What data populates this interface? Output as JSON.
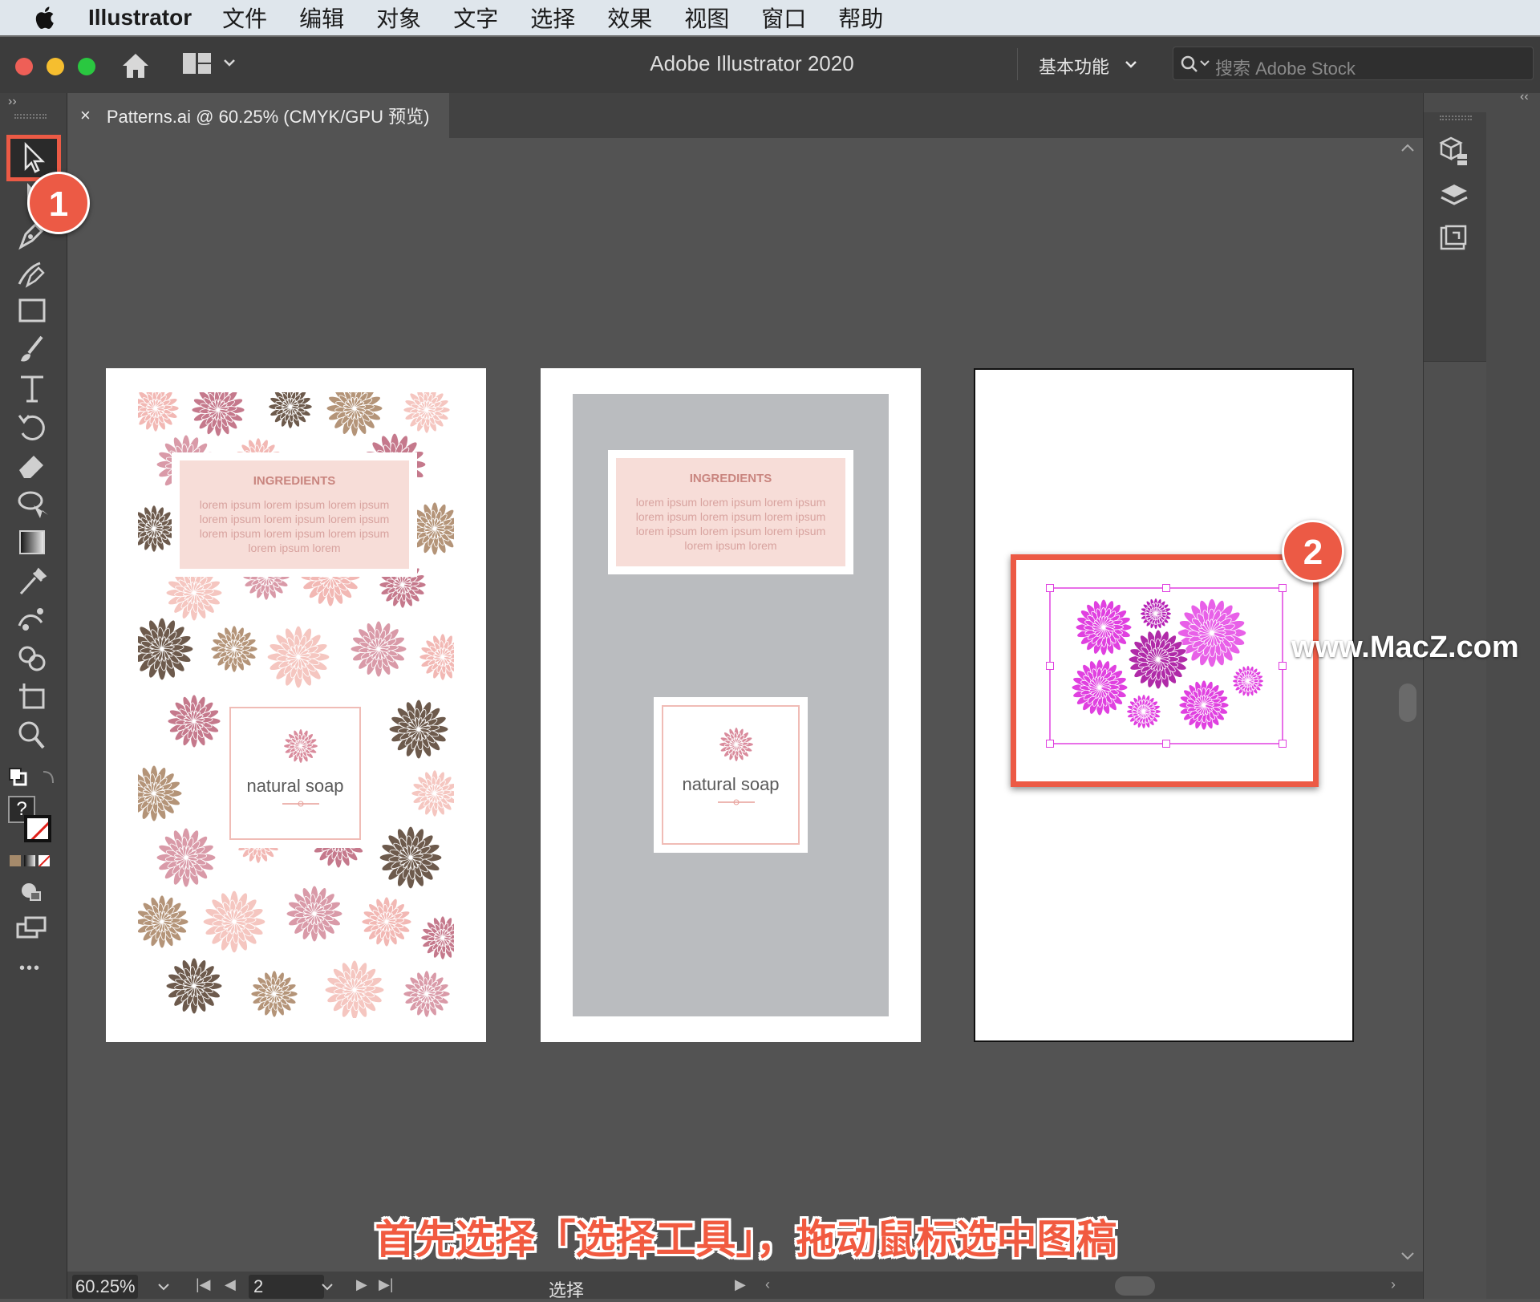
{
  "menubar": {
    "app_name": "Illustrator",
    "items": [
      "文件",
      "编辑",
      "对象",
      "文字",
      "选择",
      "效果",
      "视图",
      "窗口",
      "帮助"
    ]
  },
  "titlebar": {
    "title": "Adobe Illustrator 2020",
    "workspace": "基本功能",
    "search_placeholder": "搜索 Adobe Stock"
  },
  "document_tab": {
    "close": "×",
    "label": "Patterns.ai @ 60.25% (CMYK/GPU 预览)"
  },
  "toolbar": {
    "tools": [
      "selection-tool",
      "direct-selection-tool",
      "pen-tool",
      "curvature-tool",
      "rectangle-tool",
      "paintbrush-tool",
      "type-tool",
      "rotate-tool",
      "eraser-tool",
      "lasso-tool",
      "gradient-tool",
      "eyedropper-tool",
      "puppet-warp-tool",
      "shape-builder-tool",
      "artboard-tool",
      "zoom-tool"
    ],
    "more": "•••",
    "fill_label": "?"
  },
  "artboards": [
    {
      "ingredients_title": "INGREDIENTS",
      "ingredients_text": "lorem ipsum lorem ipsum lorem ipsum lorem ipsum lorem ipsum lorem ipsum lorem ipsum lorem ipsum lorem ipsum lorem ipsum lorem",
      "soap_label": "natural soap"
    },
    {
      "ingredients_title": "INGREDIENTS",
      "ingredients_text": "lorem ipsum lorem ipsum lorem ipsum lorem ipsum lorem ipsum lorem ipsum lorem ipsum lorem ipsum lorem ipsum lorem ipsum lorem",
      "soap_label": "natural soap"
    }
  ],
  "callouts": {
    "one": "1",
    "two": "2"
  },
  "caption": "首先选择「选择工具」，拖动鼠标选中图稿",
  "watermark": "www.MacZ.com",
  "statusbar": {
    "zoom": "60.25%",
    "artboard_number": "2",
    "current_tool": "选择"
  },
  "colors": {
    "accent": "#ec5a45",
    "selection": "#e040e0",
    "pattern_pink": "#f2b8b4",
    "pattern_rose": "#c5798c",
    "pattern_brown": "#6d5a4c",
    "pattern_tan": "#b49478"
  }
}
